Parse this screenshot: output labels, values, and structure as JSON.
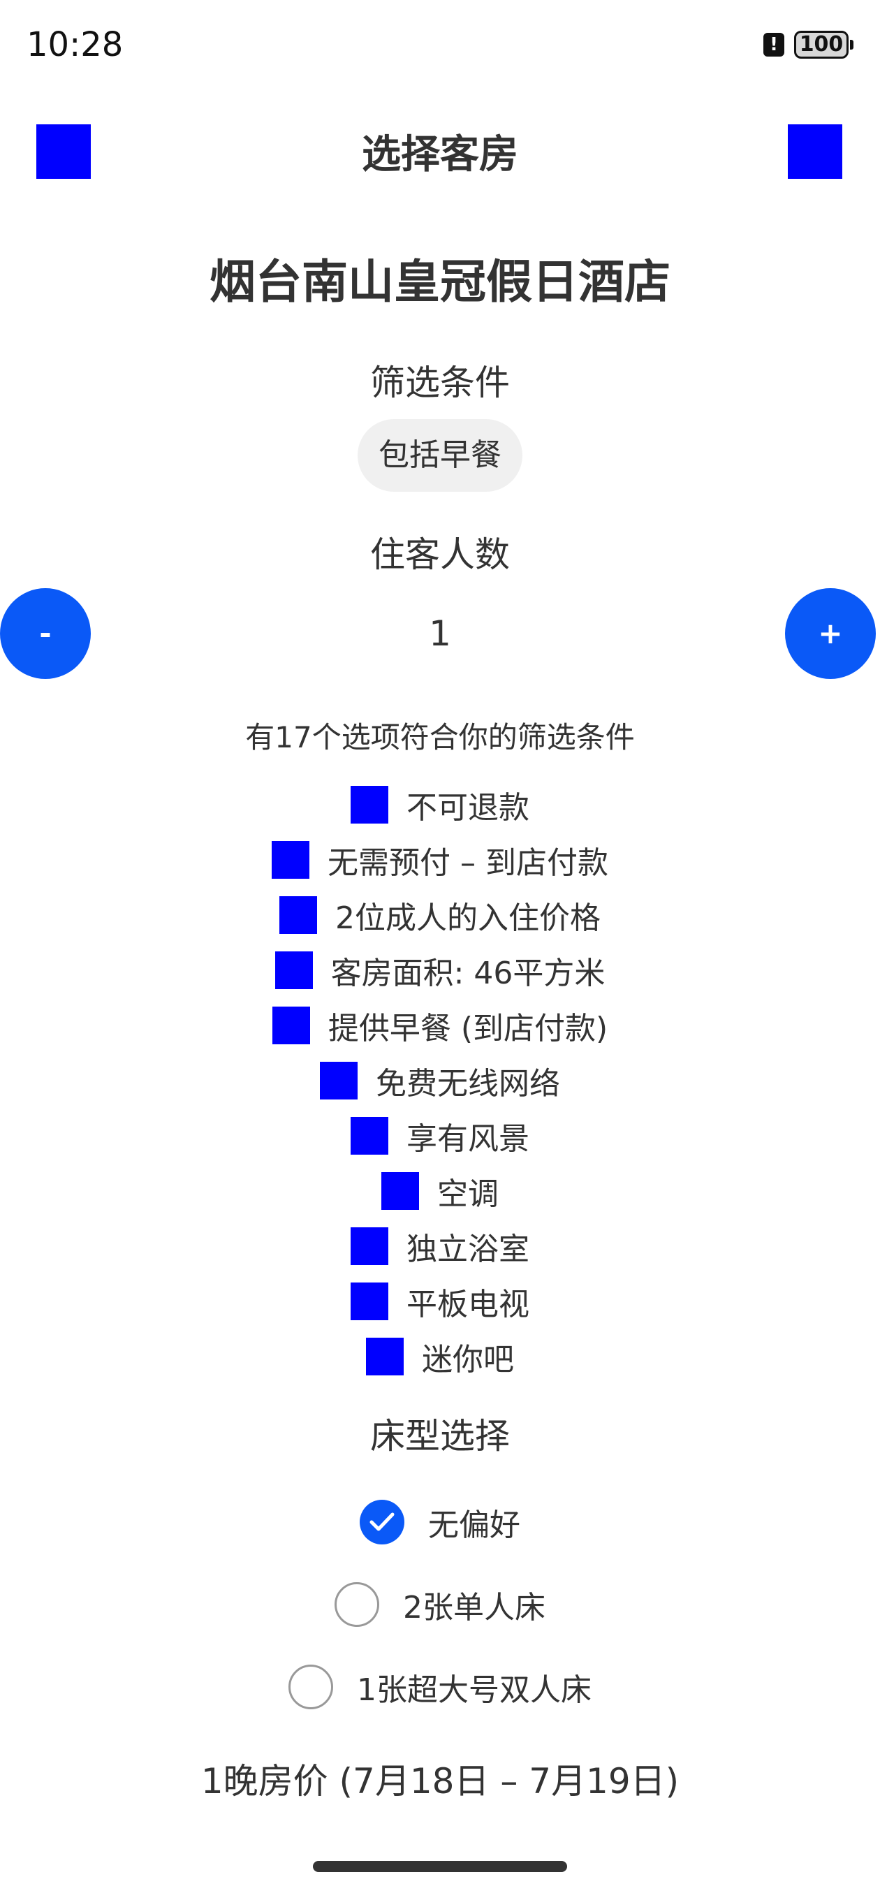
{
  "status_bar": {
    "time": "10:28",
    "battery": "100",
    "alert": "!"
  },
  "header": {
    "title": "选择客房",
    "left_icon": "back-icon",
    "right_icon": "more-icon"
  },
  "hotel_name": "烟台南山皇冠假日酒店",
  "filters": {
    "heading": "筛选条件",
    "chip": "包括早餐"
  },
  "guests": {
    "heading": "住客人数",
    "minus": "-",
    "plus": "+",
    "count": "1"
  },
  "match_text": "有17个选项符合你的筛选条件",
  "features": [
    "不可退款",
    "无需预付 – 到店付款",
    "2位成人的入住价格",
    "客房面积: 46平方米",
    "提供早餐 (到店付款)",
    "免费无线网络",
    "享有风景",
    "空调",
    "独立浴室",
    "平板电视",
    "迷你吧"
  ],
  "bed": {
    "heading": "床型选择",
    "options": [
      {
        "label": "无偏好",
        "checked": true
      },
      {
        "label": "2张单人床",
        "checked": false
      },
      {
        "label": "1张超大号双人床",
        "checked": false
      }
    ]
  },
  "price_heading": "1晚房价 (7月18日 – 7月19日)",
  "colors": {
    "accent": "#0a59f7",
    "icon_placeholder": "#0000ff",
    "chip_bg": "#f0f0f0"
  }
}
